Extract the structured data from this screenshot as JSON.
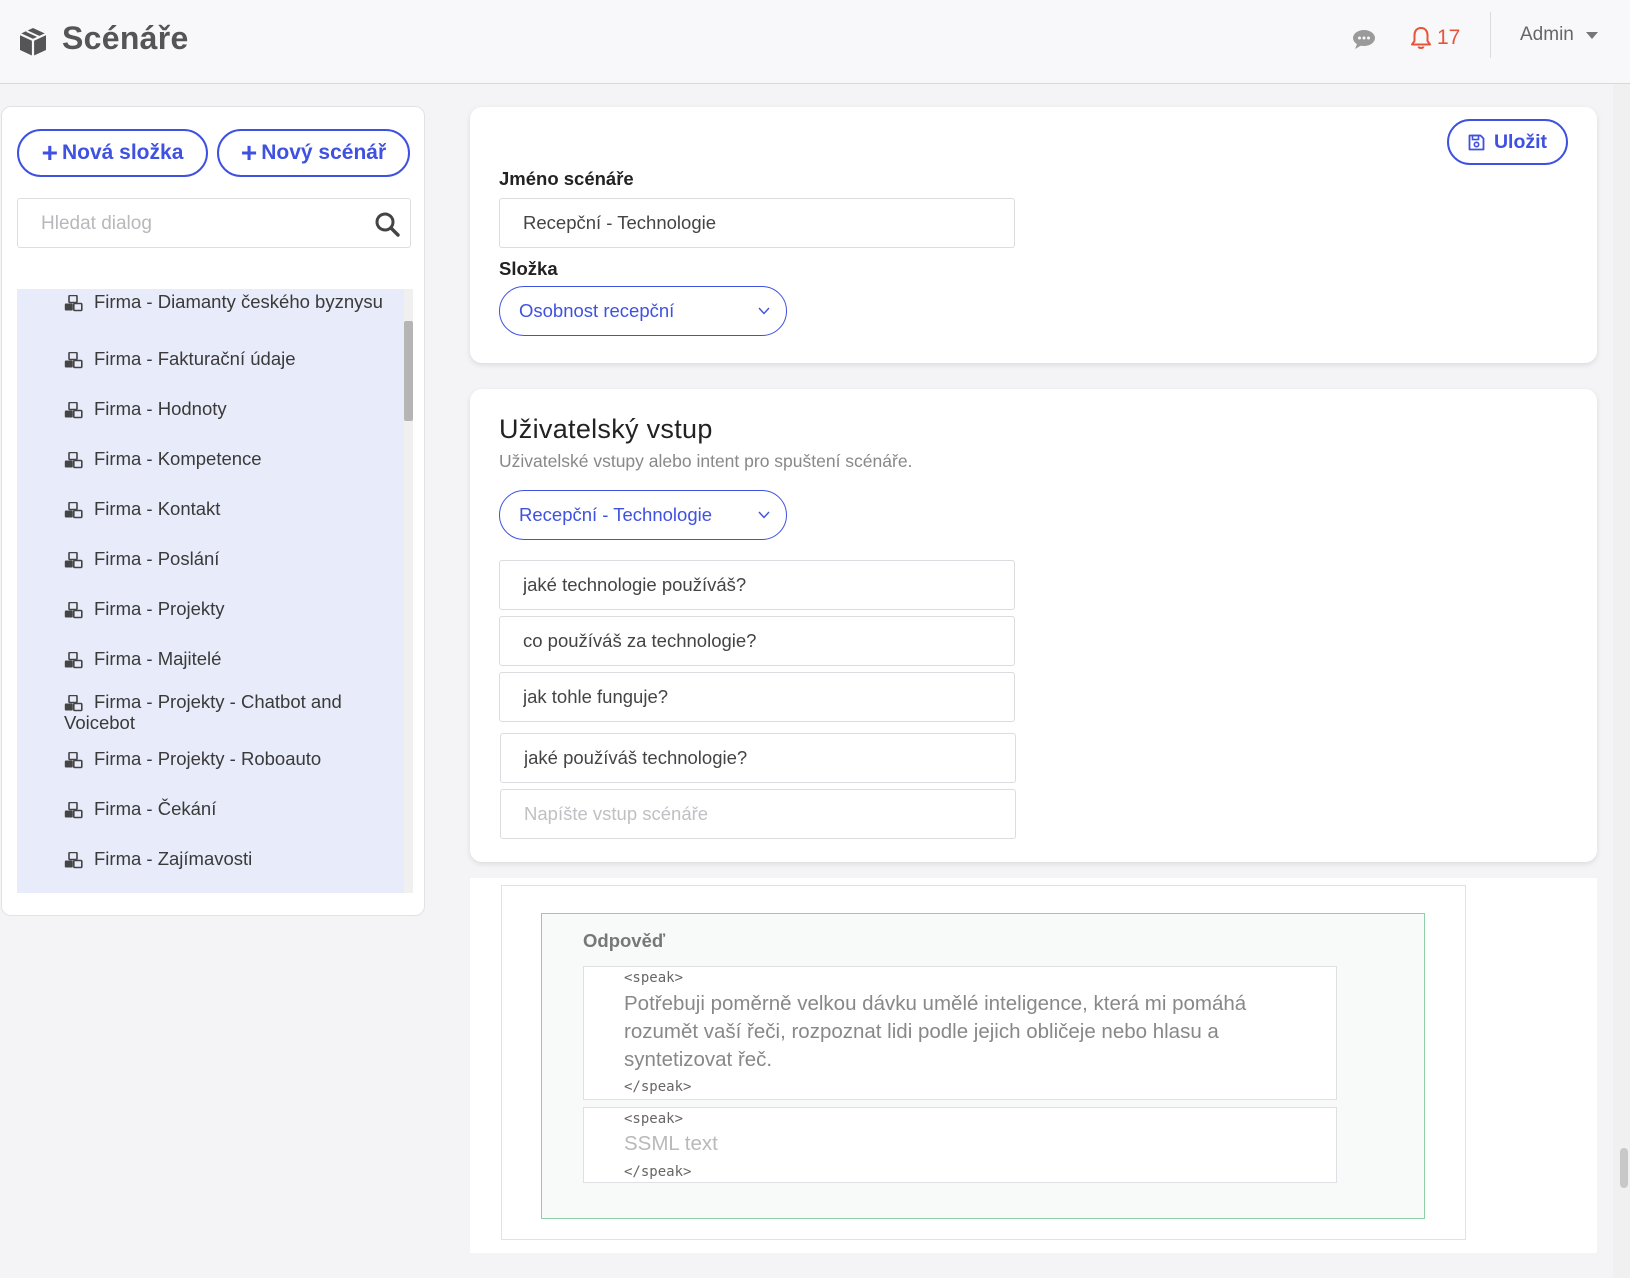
{
  "header": {
    "title": "Scénáře",
    "notifications_count": "17",
    "user_label": "Admin"
  },
  "sidebar": {
    "new_folder_label": "Nová složka",
    "new_scenario_label": "Nový scénář",
    "search_placeholder": "Hledat dialog",
    "items": [
      {
        "label": "Firma - Diamanty českého byznysu"
      },
      {
        "label": "Firma - Fakturační údaje"
      },
      {
        "label": "Firma - Hodnoty"
      },
      {
        "label": "Firma - Kompetence"
      },
      {
        "label": "Firma - Kontakt"
      },
      {
        "label": "Firma - Poslání"
      },
      {
        "label": "Firma - Projekty"
      },
      {
        "label": "Firma - Majitelé"
      },
      {
        "label": "Firma - Projekty - Chatbot and Voicebot"
      },
      {
        "label": "Firma - Projekty - Roboauto"
      },
      {
        "label": "Firma - Čekání"
      },
      {
        "label": "Firma - Zajímavosti"
      }
    ]
  },
  "scenario": {
    "save_label": "Uložit",
    "name_label": "Jméno scénáře",
    "name_value": "Recepční - Technologie",
    "folder_label": "Složka",
    "folder_value": "Osobnost recepční"
  },
  "user_input": {
    "title": "Uživatelský vstup",
    "subtitle": "Uživatelské vstupy alebo intent pro spuštení scénáře.",
    "intent_value": "Recepční - Technologie",
    "phrases": [
      "jaké technologie používáš?",
      "co používáš za technologie?",
      "jak tohle funguje?",
      "jaké používáš technologie?"
    ],
    "new_phrase_placeholder": "Napíšte vstup scénáře"
  },
  "response": {
    "label": "Odpověď",
    "open_tag": "<speak>",
    "close_tag": "</speak>",
    "text": "Potřebuji poměrně velkou dávku umělé inteligence, která mi pomáhá rozumět vaší řeči, rozpoznat lidi podle jejich obličeje nebo hlasu a syntetizovat řeč.",
    "new_text_placeholder": "SSML text"
  },
  "colors": {
    "accent": "#3f51e0",
    "notification": "#e8543a",
    "selection_bg": "#e8ebf9",
    "response_border": "#8fcfa8"
  },
  "icons": {
    "logo": "box-icon",
    "chat": "chat-bubble-icon",
    "notifications": "bell-icon",
    "search": "search-icon",
    "save": "floppy-disk-icon",
    "tree_item": "cubes-icon"
  }
}
